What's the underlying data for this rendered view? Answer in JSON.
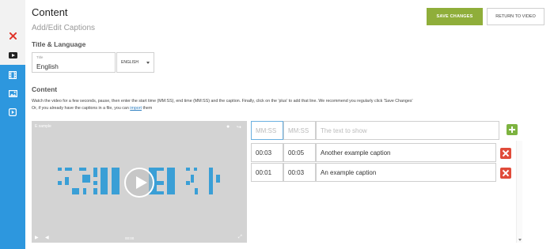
{
  "header": {
    "title": "Content",
    "subtitle": "Add/Edit Captions",
    "save_label": "Save Changes",
    "return_label": "Return to video"
  },
  "sidebar": {
    "items": [
      {
        "icon": "close-icon",
        "color": "#e0342a"
      },
      {
        "icon": "video-play-icon"
      },
      {
        "icon": "film-icon"
      },
      {
        "icon": "image-icon"
      },
      {
        "icon": "play-square-icon"
      }
    ]
  },
  "title_language": {
    "heading": "Title & Language",
    "title_label": "Title",
    "title_value": "English",
    "language_value": "ENGLISH"
  },
  "content": {
    "heading": "Content",
    "instructions_line1": "Watch the video for a few seconds, pause, then enter the start time (MM:SS), end time (MM:SS) and the caption. Finally, click on the 'plus' to add that line. We recommend you regularly click 'Save Changes'",
    "instructions_line2_prefix": "Or, if you already have the captions in a file, you can ",
    "import_link": "import",
    "instructions_line2_suffix": " them"
  },
  "video": {
    "title": "E xample",
    "time": "00:00"
  },
  "editor": {
    "new_row": {
      "start_placeholder": "MM:SS",
      "end_placeholder": "MM:SS",
      "text_placeholder": "The text to show"
    },
    "rows": [
      {
        "start": "00:03",
        "end": "00:05",
        "text": "Another example caption"
      },
      {
        "start": "00:01",
        "end": "00:03",
        "text": "An example caption"
      }
    ]
  },
  "colors": {
    "accent_blue": "#2d97de",
    "save_green": "#8fae3a",
    "delete_red": "#e04b3a",
    "add_green": "#7db340"
  }
}
